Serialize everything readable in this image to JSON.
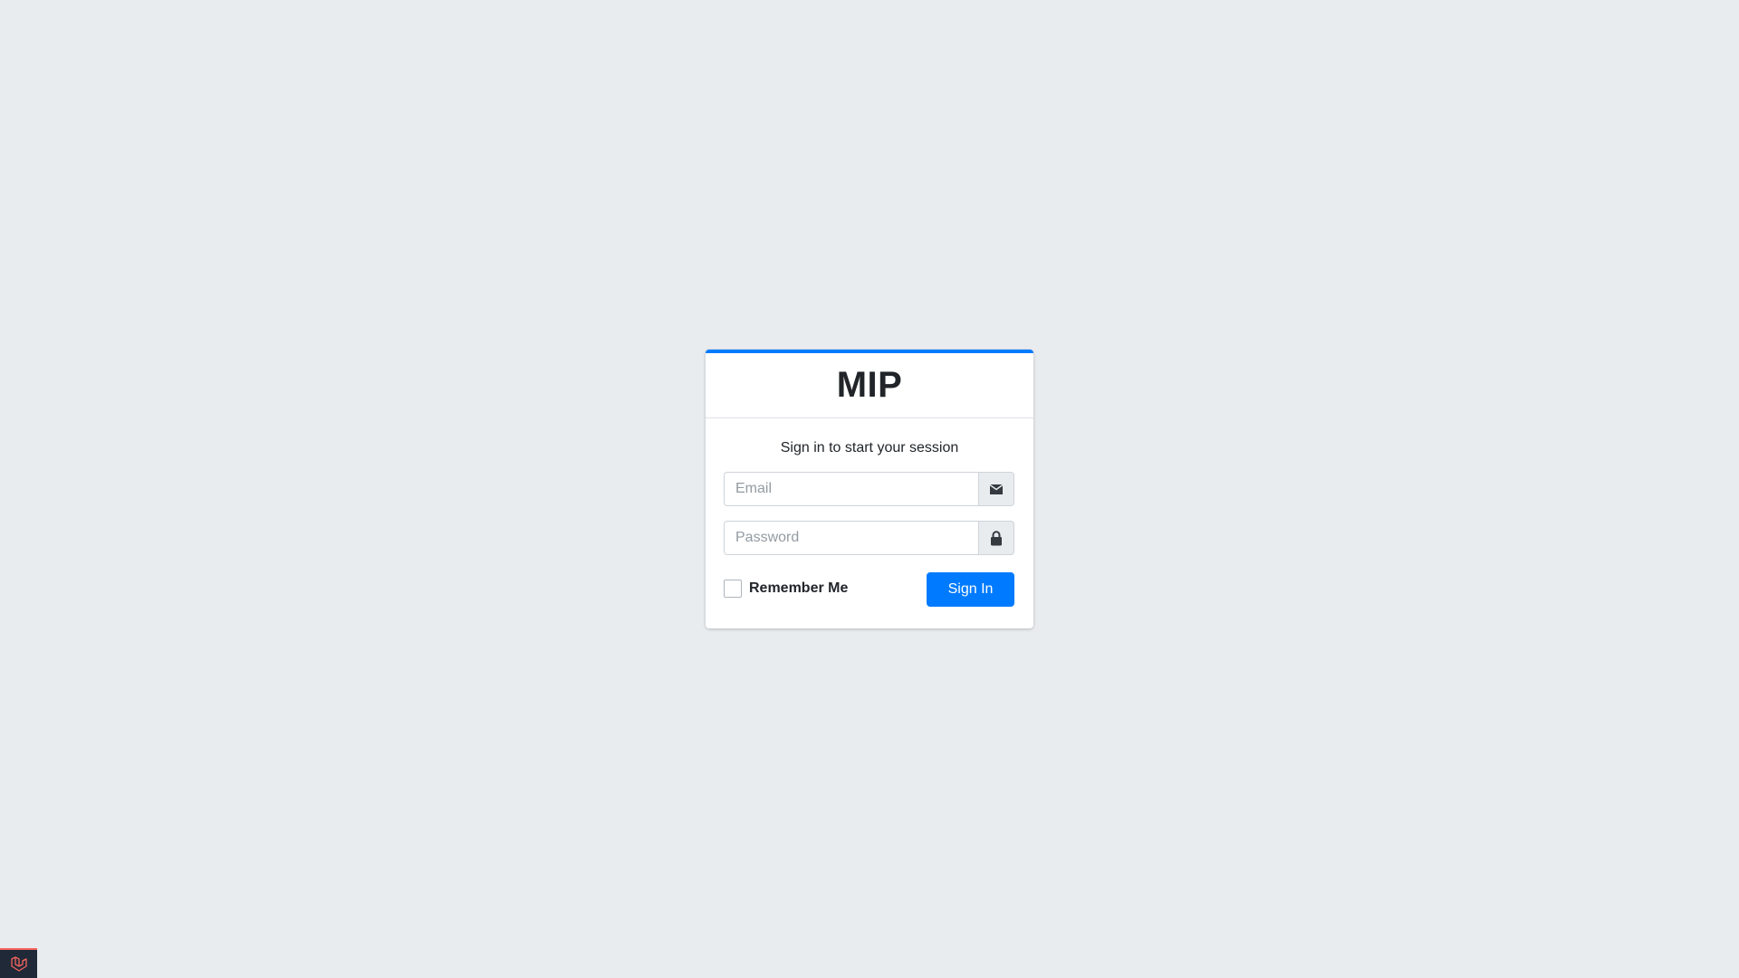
{
  "brand": {
    "title": "MIP"
  },
  "login": {
    "message": "Sign in to start your session",
    "email": {
      "placeholder": "Email",
      "value": "",
      "icon": "envelope-icon"
    },
    "password": {
      "placeholder": "Password",
      "value": "",
      "icon": "lock-icon"
    },
    "remember_label": "Remember Me",
    "remember_checked": false,
    "submit_label": "Sign In"
  },
  "debugbar": {
    "icon": "laravel-logo-icon"
  },
  "colors": {
    "background": "#e9ecef",
    "accent": "#007bff",
    "card": "#ffffff",
    "debugbar_bg": "#1f2937",
    "debugbar_accent": "#f4645f"
  }
}
